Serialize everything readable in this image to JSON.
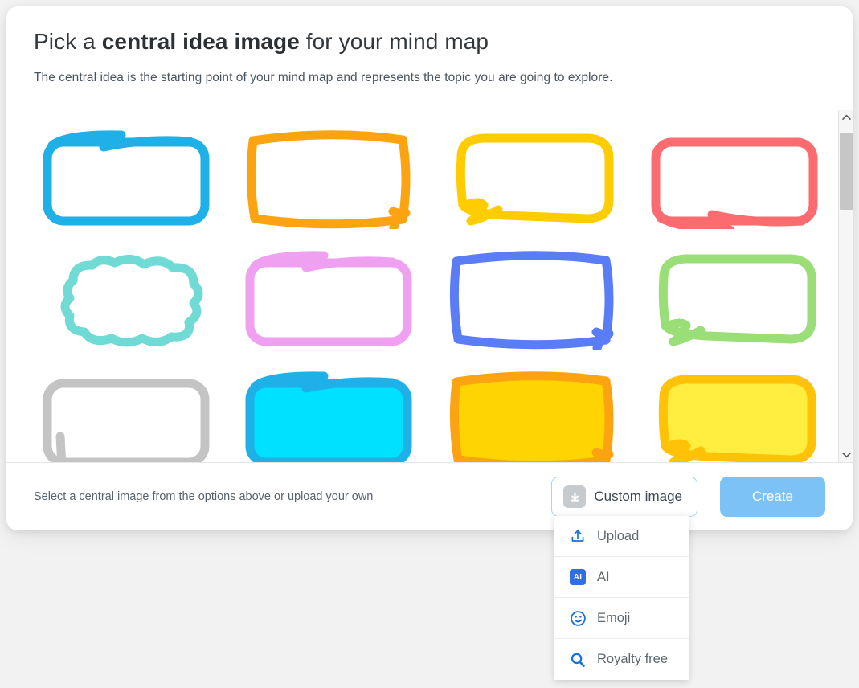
{
  "modal": {
    "title_prefix": "Pick a ",
    "title_bold": "central idea image",
    "title_suffix": " for your mind map",
    "subtitle": "The central idea is the starting point of your mind map and represents the topic you are going to explore."
  },
  "footer": {
    "hint": "Select a central image from the options above or upload your own",
    "custom_image_label": "Custom image",
    "custom_image_icon": "download-icon",
    "create_label": "Create",
    "create_color": "#7cc2f7"
  },
  "dropdown": {
    "items": [
      {
        "label": "Upload",
        "icon": "upload-icon",
        "color": "#1472e6"
      },
      {
        "label": "AI",
        "icon": "ai-badge-icon",
        "color": "#2f6fe4"
      },
      {
        "label": "Emoji",
        "icon": "smiley-icon",
        "color": "#1472e6"
      },
      {
        "label": "Royalty free",
        "icon": "search-icon",
        "color": "#1472e6"
      }
    ]
  },
  "scrollbar": {
    "up_icon": "chevron-up-icon",
    "down_icon": "chevron-down-icon",
    "thumb_color": "#c6c6c6"
  },
  "shape_grid": {
    "rows": [
      [
        {
          "name": "rounded-rect-overlap-top",
          "color": "#1fb0e8",
          "fill": "none",
          "style": "rounded"
        },
        {
          "name": "sketch-rect",
          "color": "#fca311",
          "fill": "none",
          "style": "sketch"
        },
        {
          "name": "speech-bubble",
          "color": "#ffcc00",
          "fill": "none",
          "style": "bubble"
        },
        {
          "name": "rounded-rect-overlap-bottom",
          "color": "#fb6b6f",
          "fill": "none",
          "style": "rounded-b"
        }
      ],
      [
        {
          "name": "cloud",
          "color": "#6fdbd4",
          "fill": "none",
          "style": "cloud"
        },
        {
          "name": "rounded-rect-overlap-top",
          "color": "#f0a0f0",
          "fill": "none",
          "style": "rounded"
        },
        {
          "name": "sketch-rect",
          "color": "#5a7df5",
          "fill": "none",
          "style": "sketch"
        },
        {
          "name": "speech-bubble",
          "color": "#9ade77",
          "fill": "none",
          "style": "bubble"
        }
      ],
      [
        {
          "name": "rounded-rect",
          "color": "#c4c4c4",
          "fill": "none",
          "style": "rounded-plain"
        },
        {
          "name": "rounded-rect-filled",
          "color": "#1fb0e8",
          "fill": "#00e0ff",
          "style": "rounded"
        },
        {
          "name": "sketch-rect-filled",
          "color": "#fca311",
          "fill": "#ffd400",
          "style": "sketch"
        },
        {
          "name": "speech-bubble-filled",
          "color": "#ffc207",
          "fill": "#ffee3f",
          "style": "bubble"
        }
      ]
    ]
  }
}
